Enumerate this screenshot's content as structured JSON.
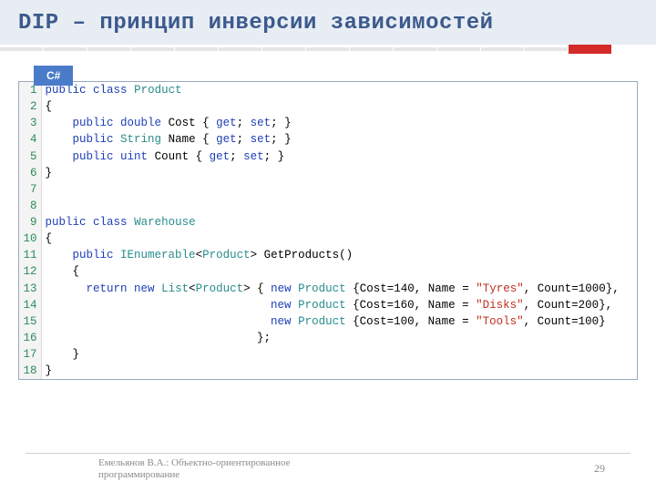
{
  "title": "DIP – принцип инверсии зависимостей",
  "lang_tab": "C#",
  "code_lines": [
    {
      "n": 1,
      "html": "<span class='kw'>public</span> <span class='kw'>class</span> <span class='cls'>Product</span>"
    },
    {
      "n": 2,
      "html": "{"
    },
    {
      "n": 3,
      "html": "    <span class='kw'>public</span> <span class='typ'>double</span> Cost { <span class='kw'>get</span>; <span class='kw'>set</span>; }"
    },
    {
      "n": 4,
      "html": "    <span class='kw'>public</span> <span class='cls'>String</span> Name { <span class='kw'>get</span>; <span class='kw'>set</span>; }"
    },
    {
      "n": 5,
      "html": "    <span class='kw'>public</span> <span class='typ'>uint</span> Count { <span class='kw'>get</span>; <span class='kw'>set</span>; }"
    },
    {
      "n": 6,
      "html": "}"
    },
    {
      "n": 7,
      "html": ""
    },
    {
      "n": 8,
      "html": ""
    },
    {
      "n": 9,
      "html": "<span class='kw'>public</span> <span class='kw'>class</span> <span class='cls'>Warehouse</span>"
    },
    {
      "n": 10,
      "html": "{"
    },
    {
      "n": 11,
      "html": "    <span class='kw'>public</span> <span class='cls'>IEnumerable</span>&lt;<span class='cls'>Product</span>&gt; GetProducts()"
    },
    {
      "n": 12,
      "html": "    {"
    },
    {
      "n": 13,
      "html": "      <span class='kw'>return</span> <span class='kw'>new</span> <span class='cls'>List</span>&lt;<span class='cls'>Product</span>&gt; { <span class='kw'>new</span> <span class='cls'>Product</span> {Cost=140, Name = <span class='str'>\"Tyres\"</span>, Count=1000},"
    },
    {
      "n": 14,
      "html": "                                 <span class='kw'>new</span> <span class='cls'>Product</span> {Cost=160, Name = <span class='str'>\"Disks\"</span>, Count=200},"
    },
    {
      "n": 15,
      "html": "                                 <span class='kw'>new</span> <span class='cls'>Product</span> {Cost=100, Name = <span class='str'>\"Tools\"</span>, Count=100}"
    },
    {
      "n": 16,
      "html": "                               };"
    },
    {
      "n": 17,
      "html": "    }"
    },
    {
      "n": 18,
      "html": "}"
    }
  ],
  "footer": {
    "text_line1": "Емельянов В.А.: Объектно-ориентированное",
    "text_line2": "программирование",
    "page": "29"
  }
}
